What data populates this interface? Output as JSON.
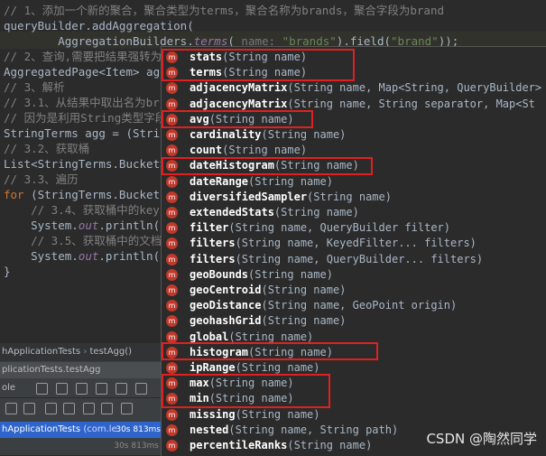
{
  "code": {
    "line1": "// 1、添加一个新的聚合，聚合类型为terms，聚合名称为brands，聚合字段为brand",
    "line2": "queryBuilder.addAggregation(",
    "line3_a": "        AggregationBuilders.",
    "line3_b": "terms",
    "line3_c": "( ",
    "line3_hint": "name: ",
    "line3_str": "\"brands\"",
    "line3_d": ").field(",
    "line3_str2": "\"brand\"",
    "line3_e": "));",
    "line4": "// 2、查询,需要把结果强转为",
    "line5": "AggregatedPage<Item> agg",
    "line6": "// 3、解析",
    "line7": "// 3.1、从结果中取出名为br",
    "line8": "// 因为是利用String类型字段",
    "line9": "StringTerms agg = (Strin",
    "line10": "// 3.2、获取桶",
    "line11": "List<StringTerms.Bucket>",
    "line12": "// 3.3、遍历",
    "line13_kw": "for",
    "line13": " (StringTerms.Bucket",
    "line14": "    // 3.4、获取桶中的key",
    "line15_a": "    System.",
    "line15_it": "out",
    "line15_b": ".println(b",
    "line16": "    // 3.5、获取桶中的文档",
    "line17_a": "    System.",
    "line17_it": "out",
    "line17_b": ".println(b",
    "line18": "}"
  },
  "bottom_panel": {
    "breadcrumb_left": "hApplicationTests",
    "breadcrumb_sep": "›",
    "breadcrumb_method": "testAgg()",
    "run_tab": "plicationTests.testAgg",
    "console_label": "ole",
    "test_row_name": "hApplicationTests",
    "test_row_pkg": "(com.le",
    "test_row_time": "30s 813ms",
    "time2": "30s 813ms",
    "time3": "30s 813ms"
  },
  "completion": {
    "icon_letter": "m",
    "items": [
      {
        "name": "stats",
        "params": "(String name)"
      },
      {
        "name": "terms",
        "params": "(String name)"
      },
      {
        "name": "adjacencyMatrix",
        "params": "(String name, Map<String, QueryBuilder>"
      },
      {
        "name": "adjacencyMatrix",
        "params": "(String name, String separator, Map<St"
      },
      {
        "name": "avg",
        "params": "(String name)"
      },
      {
        "name": "cardinality",
        "params": "(String name)"
      },
      {
        "name": "count",
        "params": "(String name)"
      },
      {
        "name": "dateHistogram",
        "params": "(String name)"
      },
      {
        "name": "dateRange",
        "params": "(String name)"
      },
      {
        "name": "diversifiedSampler",
        "params": "(String name)"
      },
      {
        "name": "extendedStats",
        "params": "(String name)"
      },
      {
        "name": "filter",
        "params": "(String name, QueryBuilder filter)"
      },
      {
        "name": "filters",
        "params": "(String name, KeyedFilter... filters)"
      },
      {
        "name": "filters",
        "params": "(String name, QueryBuilder... filters)"
      },
      {
        "name": "geoBounds",
        "params": "(String name)"
      },
      {
        "name": "geoCentroid",
        "params": "(String name)"
      },
      {
        "name": "geoDistance",
        "params": "(String name, GeoPoint origin)"
      },
      {
        "name": "geohashGrid",
        "params": "(String name)"
      },
      {
        "name": "global",
        "params": "(String name)"
      },
      {
        "name": "histogram",
        "params": "(String name)"
      },
      {
        "name": "ipRange",
        "params": "(String name)"
      },
      {
        "name": "max",
        "params": "(String name)"
      },
      {
        "name": "min",
        "params": "(String name)"
      },
      {
        "name": "missing",
        "params": "(String name)"
      },
      {
        "name": "nested",
        "params": "(String name, String path)"
      },
      {
        "name": "percentileRanks",
        "params": "(String name)"
      }
    ]
  },
  "watermark": "CSDN @陶然同学",
  "colors": {
    "highlight_box": "#e02020",
    "method_icon": "#c0392b",
    "comment": "#808080",
    "keyword": "#cc7832"
  }
}
